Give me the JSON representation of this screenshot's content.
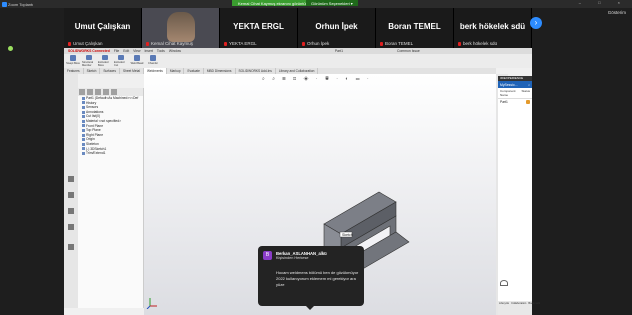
{
  "zoom": {
    "title": "Zoom Toplantı",
    "share_banner": "Kemal Cihat Kaymuş ekranını görüntülüyorsunuz",
    "view_options": "Görünüm Seçenekleri ▾",
    "gallery": "Gösterim",
    "window_controls": "– □ ×"
  },
  "participants": [
    {
      "name": "Umut Çalışkan",
      "sub": "Umut Çalışkan",
      "muted": true
    },
    {
      "name": "",
      "sub": "Kemal Cihat Kaymuş",
      "muted": true
    },
    {
      "name": "YEKTA ERGL",
      "sub": "YEKTA ERGL",
      "muted": true
    },
    {
      "name": "Orhun İpek",
      "sub": "Orhun İpek",
      "muted": true
    },
    {
      "name": "Boran TEMEL",
      "sub": "Boran TEMEL",
      "muted": true
    },
    {
      "name": "berk hökelek sdü",
      "sub": "berk hökelek sdü",
      "muted": true
    }
  ],
  "next_arrow": "›",
  "sw": {
    "logo": "SOLIDWORKS Connected",
    "menu": [
      "File",
      "Edit",
      "View",
      "Insert",
      "Tools",
      "Window",
      "Part1",
      "Common Issue"
    ],
    "commands": [
      "Swept Boss",
      "Structural Member",
      "Extruded Boss",
      "Extruded Cut",
      "Weld Bead",
      "Chamfer"
    ],
    "tabs": [
      "Features",
      "Sketch",
      "Surfaces",
      "Sheet Metal",
      "Weldments",
      "Markup",
      "Evaluate",
      "MBD Dimensions",
      "SOLIDWORKS Add-Ins",
      "Library and Collaboration"
    ],
    "active_tab": "Weldments",
    "tree": [
      "Part1 (Default<As Machined><<Def",
      "History",
      "Sensors",
      "Annotations",
      "Cut list(0)",
      "Material <not specified>",
      "Front Plane",
      "Top Plane",
      "Right Plane",
      "Origin",
      "Skeleton",
      "(-) 3DSketch1",
      "Trim/Extend1"
    ],
    "viewtools": "⌕ ⌕ ⊞ ⊡ ◈ · ◉ · ◐ ▭ ·",
    "sheet_label": "Sketch"
  },
  "pdm": {
    "header": "3DEXPERIENCE",
    "bar": "MySessio...",
    "col_name": "Component Name",
    "col_status": "Status",
    "row_name": "Part1",
    "tabs": [
      "Lifecycle",
      "Collaboration",
      "Bookmark"
    ]
  },
  "toast": {
    "avatar": "B",
    "from": "Berkan_ASLANHAN_alkü",
    "sub": "Kişisinden Herkese",
    "message": "Hocam weldmens bölümü ben de gözükmüyor 2022 kullanıyorum eklemem mi gerekiyor ara yüze"
  }
}
